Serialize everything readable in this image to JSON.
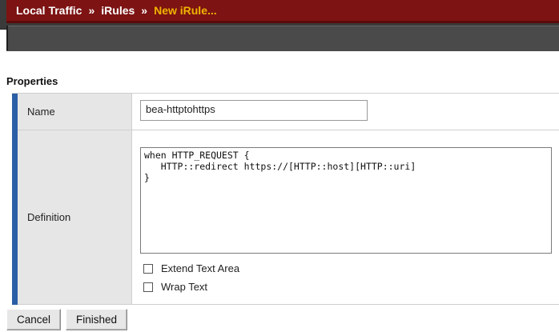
{
  "breadcrumb": {
    "items": [
      "Local Traffic",
      "iRules",
      "New iRule..."
    ],
    "separator": "»"
  },
  "properties": {
    "title": "Properties",
    "name_label": "Name",
    "name_value": "bea-httptohttps",
    "definition_label": "Definition",
    "definition_code": "when HTTP_REQUEST {\n   HTTP::redirect https://[HTTP::host][HTTP::uri]\n}",
    "extend_text_area_label": "Extend Text Area",
    "extend_text_area_checked": false,
    "wrap_text_label": "Wrap Text",
    "wrap_text_checked": false
  },
  "buttons": {
    "cancel": "Cancel",
    "finished": "Finished"
  },
  "colors": {
    "crumb_bar": "#7d1313",
    "crumb_current": "#f0b400",
    "accent_bar": "#2b5fa5",
    "label_bg": "#e6e6e6"
  }
}
